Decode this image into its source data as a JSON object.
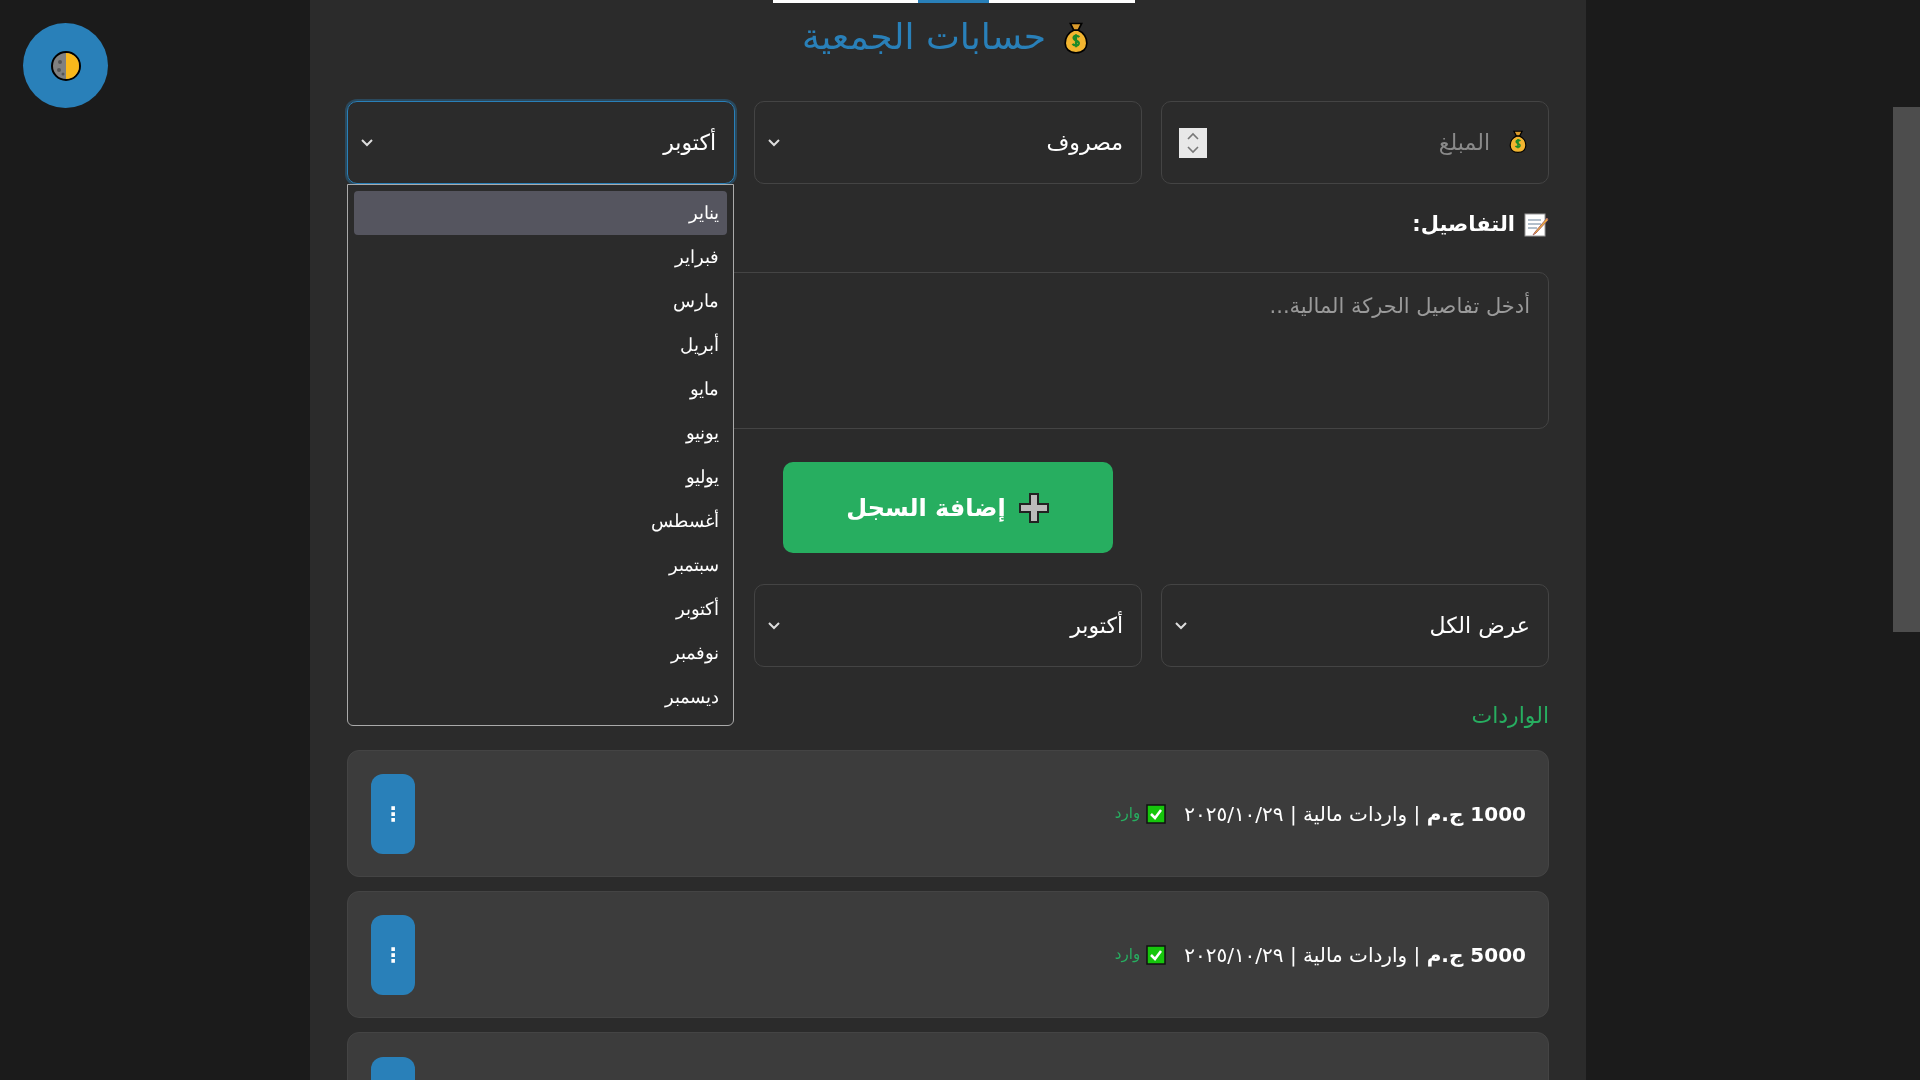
{
  "title": "حسابات الجمعية",
  "form": {
    "amount": {
      "placeholder": "المبلغ"
    },
    "type_select": {
      "value": "مصروف"
    },
    "month_select": {
      "value": "أكتوبر",
      "open": true,
      "options": [
        {
          "label": "يناير",
          "highlighted": true
        },
        {
          "label": "فبراير",
          "highlighted": false
        },
        {
          "label": "مارس",
          "highlighted": false
        },
        {
          "label": "أبريل",
          "highlighted": false
        },
        {
          "label": "مايو",
          "highlighted": false
        },
        {
          "label": "يونيو",
          "highlighted": false
        },
        {
          "label": "يوليو",
          "highlighted": false
        },
        {
          "label": "أغسطس",
          "highlighted": false
        },
        {
          "label": "سبتمبر",
          "highlighted": false
        },
        {
          "label": "أكتوبر",
          "highlighted": false
        },
        {
          "label": "نوفمبر",
          "highlighted": false
        },
        {
          "label": "ديسمبر",
          "highlighted": false
        }
      ]
    },
    "details_label": "التفاصيل:",
    "details": {
      "placeholder": "أدخل تفاصيل الحركة المالية..."
    },
    "add_button": "إضافة السجل"
  },
  "filters": [
    {
      "value": "عرض الكل"
    },
    {
      "value": "أكتوبر"
    }
  ],
  "incomes": {
    "heading": "الواردات",
    "more_below": true,
    "records": [
      {
        "text": "**1000 ج.م** | واردات مالية | ٢٠٢٥/١٠/٢٩",
        "checked": true,
        "tag": "وارد",
        "menu": "⋮"
      },
      {
        "text": "**5000 ج.م** | واردات مالية | ٢٠٢٥/١٠/٢٩",
        "checked": true,
        "tag": "وارد",
        "menu": "⋮"
      }
    ]
  }
}
